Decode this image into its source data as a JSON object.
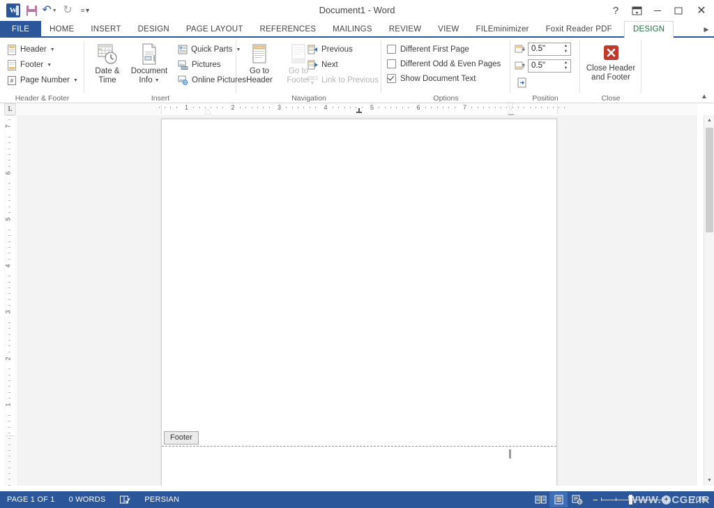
{
  "window": {
    "title": "Document1 - Word",
    "quick_access": [
      {
        "name": "word-logo",
        "label": "W"
      },
      {
        "name": "save",
        "label": "Save"
      },
      {
        "name": "undo",
        "label": "Undo"
      },
      {
        "name": "redo",
        "label": "Redo"
      },
      {
        "name": "customize",
        "label": "Customize Quick Access Toolbar"
      }
    ],
    "controls": {
      "help": "?",
      "ribbon_display": "Ribbon Display Options",
      "minimize": "–",
      "maximize": "☐",
      "close": "✕"
    }
  },
  "tabs": [
    {
      "label": "FILE",
      "state": "file"
    },
    {
      "label": "HOME",
      "state": "normal"
    },
    {
      "label": "INSERT",
      "state": "normal"
    },
    {
      "label": "DESIGN",
      "state": "normal"
    },
    {
      "label": "PAGE LAYOUT",
      "state": "normal"
    },
    {
      "label": "REFERENCES",
      "state": "normal"
    },
    {
      "label": "MAILINGS",
      "state": "normal"
    },
    {
      "label": "REVIEW",
      "state": "normal"
    },
    {
      "label": "VIEW",
      "state": "normal"
    },
    {
      "label": "FILEminimizer",
      "state": "normal"
    },
    {
      "label": "Foxit Reader PDF",
      "state": "normal"
    },
    {
      "label": "DESIGN",
      "state": "active"
    }
  ],
  "ribbon": {
    "groups": {
      "header_footer": {
        "label": "Header & Footer",
        "items": [
          {
            "label": "Header",
            "dropdown": true
          },
          {
            "label": "Footer",
            "dropdown": true
          },
          {
            "label": "Page Number",
            "dropdown": true
          }
        ]
      },
      "insert": {
        "label": "Insert",
        "big_items": [
          {
            "label_top": "Date &",
            "label_bottom": "Time",
            "dropdown": false
          },
          {
            "label_top": "Document",
            "label_bottom": "Info",
            "dropdown": true
          }
        ],
        "items": [
          {
            "label": "Quick Parts",
            "dropdown": true
          },
          {
            "label": "Pictures",
            "dropdown": false
          },
          {
            "label": "Online Pictures",
            "dropdown": false
          }
        ]
      },
      "navigation": {
        "label": "Navigation",
        "big_items": [
          {
            "label_top": "Go to",
            "label_bottom": "Header",
            "disabled": false
          },
          {
            "label_top": "Go to",
            "label_bottom": "Footer",
            "disabled": true
          }
        ],
        "items": [
          {
            "label": "Previous",
            "disabled": false
          },
          {
            "label": "Next",
            "disabled": false
          },
          {
            "label": "Link to Previous",
            "disabled": true
          }
        ]
      },
      "options": {
        "label": "Options",
        "checkboxes": [
          {
            "label": "Different First Page",
            "checked": false
          },
          {
            "label": "Different Odd & Even Pages",
            "checked": false
          },
          {
            "label": "Show Document Text",
            "checked": true
          }
        ]
      },
      "position": {
        "label": "Position",
        "fields": [
          {
            "name": "header-from-top",
            "value": "0.5\""
          },
          {
            "name": "footer-from-bottom",
            "value": "0.5\""
          }
        ],
        "align_button": "Insert Alignment Tab"
      },
      "close": {
        "label": "Close",
        "button_line1": "Close Header",
        "button_line2": "and Footer"
      }
    },
    "collapse_label": "Collapse the Ribbon"
  },
  "ruler": {
    "tab_selector": "L",
    "horizontal_numbers": [
      "7",
      "6",
      "5",
      "4",
      "3",
      "2",
      "1"
    ],
    "vertical_numbers": [
      "7",
      "6",
      "5",
      "4",
      "3",
      "2",
      "1"
    ]
  },
  "document": {
    "footer_tag": "Footer"
  },
  "status": {
    "page": "PAGE 1 OF 1",
    "words": "0 WORDS",
    "proofing": "Proofing errors",
    "language": "PERSIAN",
    "views": [
      {
        "name": "read-mode",
        "selected": false
      },
      {
        "name": "print-layout",
        "selected": true
      },
      {
        "name": "web-layout",
        "selected": false
      }
    ],
    "zoom_out": "−",
    "zoom_in": "+",
    "zoom_level": "70%"
  },
  "watermark": {
    "prefix": "WWW.",
    "badge": "+",
    "suffix": "CGE.IR"
  },
  "colors": {
    "word_blue": "#2b579a",
    "design_tab_green": "#1e7145",
    "close_red": "#c0392b",
    "accent_gold": "#e8c36a"
  }
}
